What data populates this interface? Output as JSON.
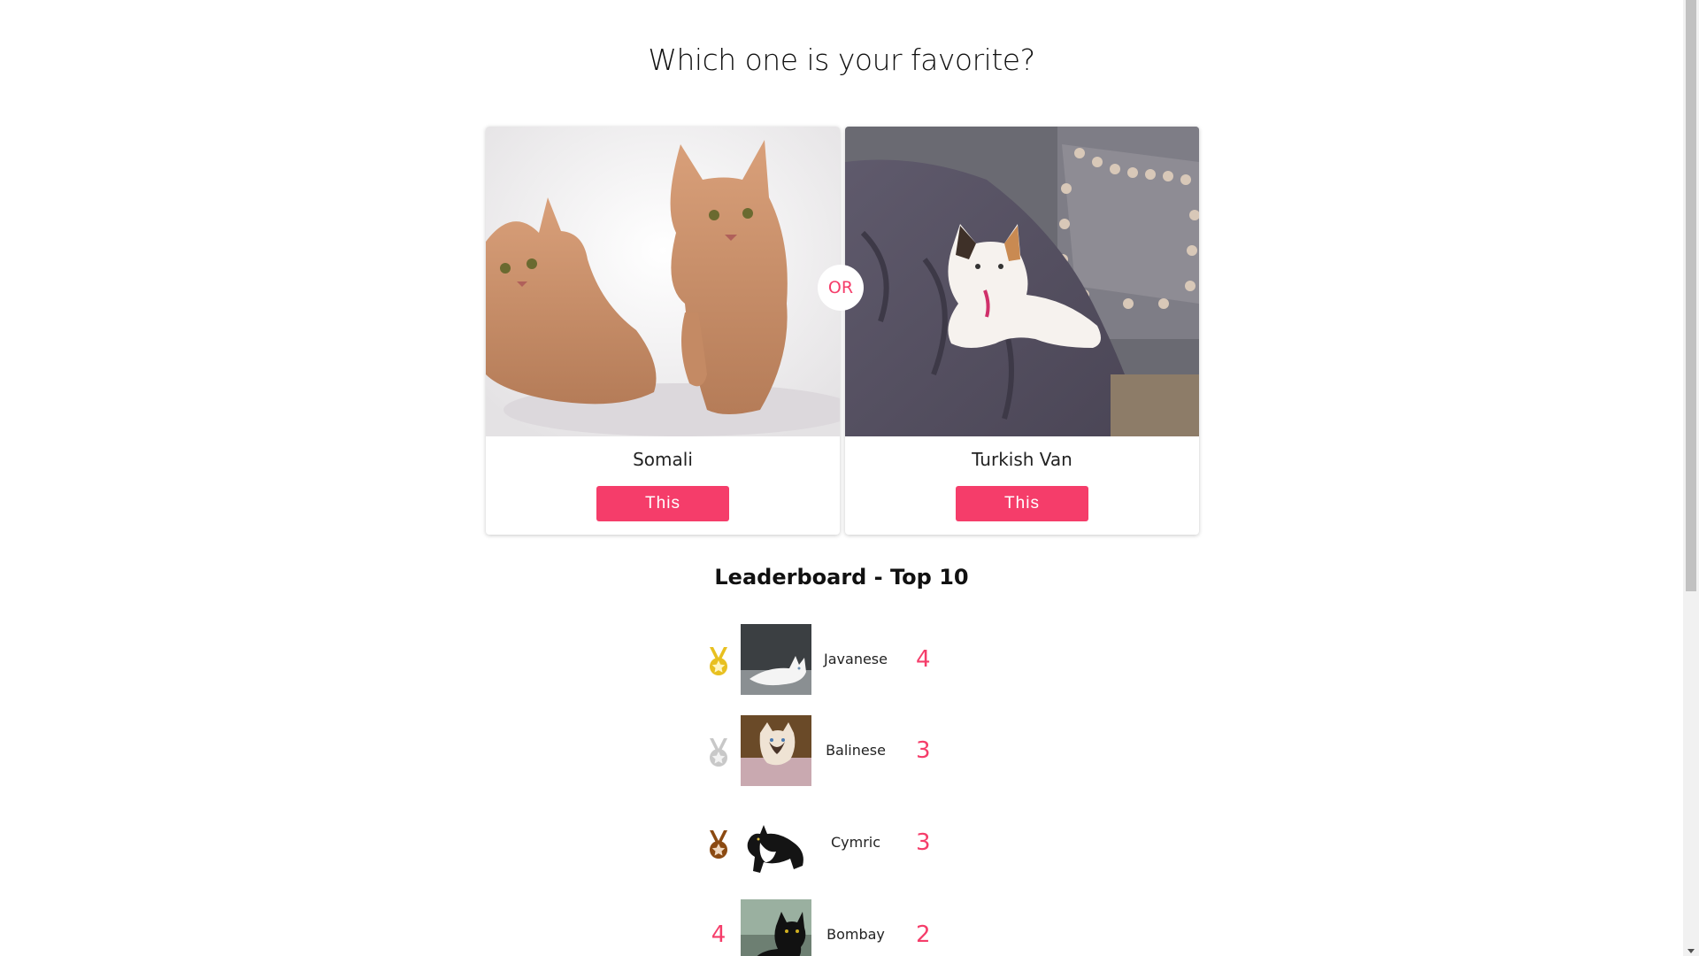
{
  "question": "Which one is your favorite?",
  "matchup": {
    "left": {
      "name": "Somali",
      "button_label": "This"
    },
    "or_label": "OR",
    "right": {
      "name": "Turkish Van",
      "button_label": "This"
    }
  },
  "leaderboard": {
    "title": "Leaderboard - Top 10",
    "rows": [
      {
        "rank_icon": "gold-medal-icon",
        "breed": "Javanese",
        "votes": "4"
      },
      {
        "rank_icon": "silver-medal-icon",
        "breed": "Balinese",
        "votes": "3"
      },
      {
        "rank_icon": "bronze-medal-icon",
        "breed": "Cymric",
        "votes": "3"
      },
      {
        "rank": "4",
        "breed": "Bombay",
        "votes": "2"
      }
    ]
  },
  "colors": {
    "accent": "#f53d6a",
    "gold": "#e8c020",
    "silver": "#c8c8c8",
    "bronze": "#8b4a12"
  }
}
